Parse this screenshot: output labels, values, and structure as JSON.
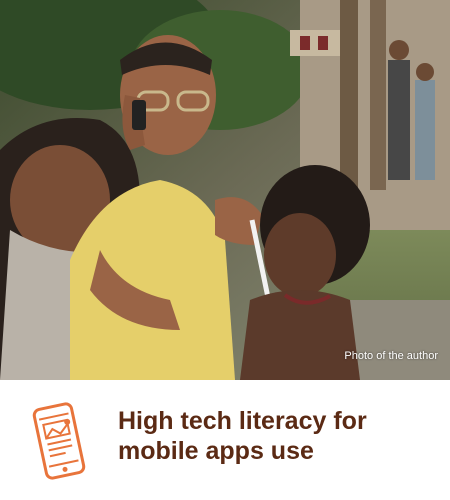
{
  "photo": {
    "caption": "Photo of the author"
  },
  "footer": {
    "icon": "smartphone-icon",
    "headline_line1": "High tech literacy for",
    "headline_line2": "mobile apps use"
  },
  "colors": {
    "headline": "#5b2a14",
    "icon_accent": "#e8743b"
  }
}
